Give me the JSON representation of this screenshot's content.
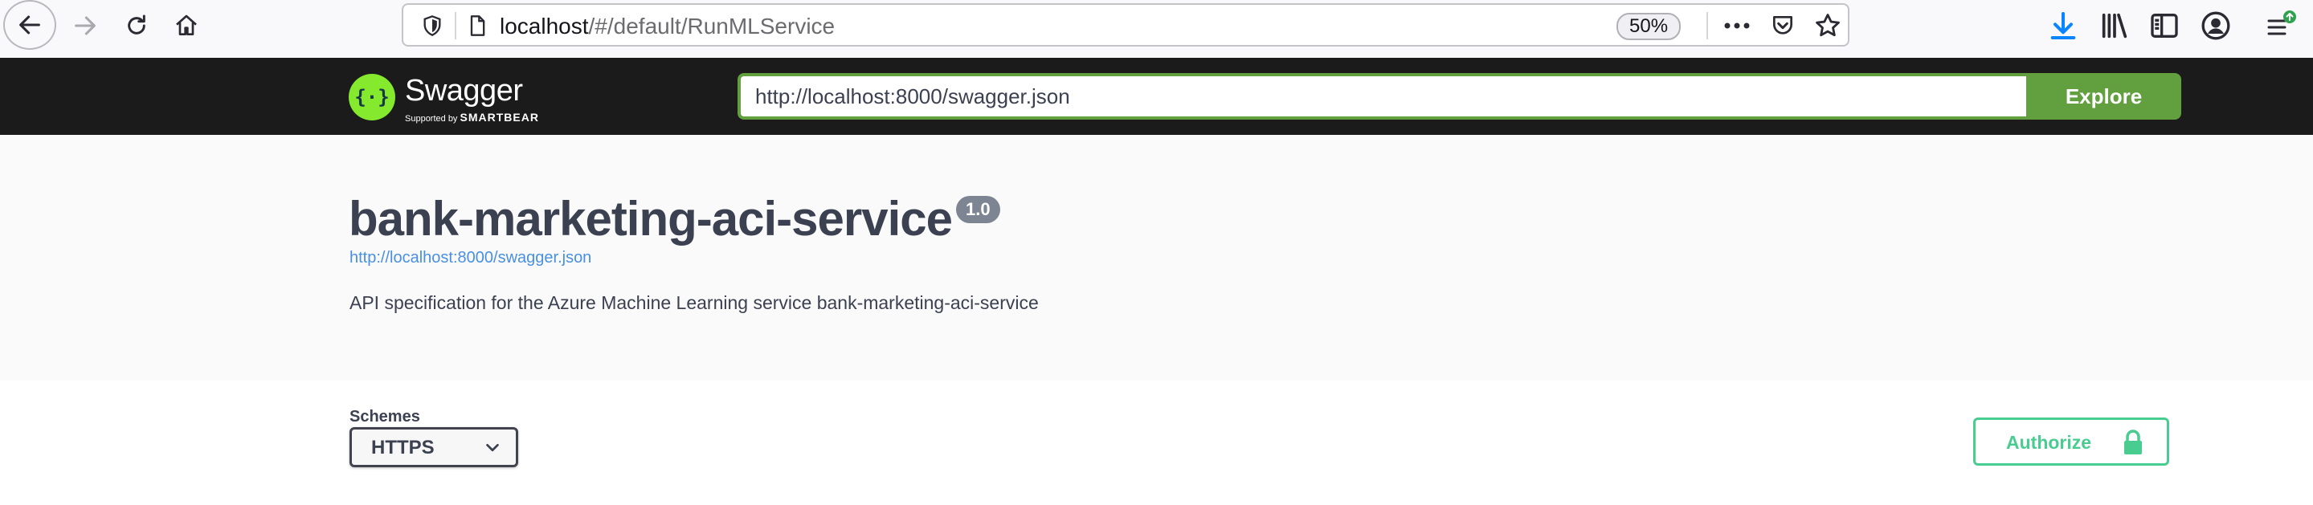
{
  "browser": {
    "url_host": "localhost",
    "url_path": "/#/default/RunMLService",
    "zoom": "50%"
  },
  "topbar": {
    "logo_title": "Swagger",
    "logo_supported": "Supported by",
    "logo_brand": "SMARTBEAR",
    "spec_url": "http://localhost:8000/swagger.json",
    "explore_label": "Explore"
  },
  "info": {
    "title": "bank-marketing-aci-service",
    "version": "1.0",
    "spec_link": "http://localhost:8000/swagger.json",
    "description": "API specification for the Azure Machine Learning service bank-marketing-aci-service"
  },
  "schemes": {
    "label": "Schemes",
    "selected": "HTTPS"
  },
  "authorize": {
    "label": "Authorize"
  },
  "colors": {
    "swagger_green": "#85ea2d",
    "explore_green": "#62a03f",
    "authorize_green": "#49cc90",
    "link_blue": "#4990e2",
    "topbar_bg": "#1b1b1b",
    "download_blue": "#0a84ff"
  },
  "icons": [
    "back-arrow-icon",
    "forward-arrow-icon",
    "reload-icon",
    "home-icon",
    "shield-icon",
    "page-icon",
    "more-icon",
    "pocket-icon",
    "star-icon",
    "download-icon",
    "library-icon",
    "sidebar-icon",
    "account-icon",
    "menu-icon",
    "lock-icon",
    "chevron-down-icon"
  ]
}
